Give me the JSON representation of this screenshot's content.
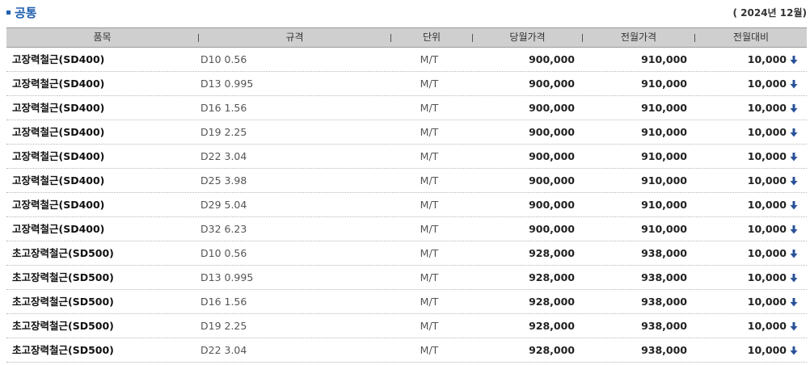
{
  "section": {
    "title": "공통",
    "period": "( 2024년 12월)"
  },
  "table": {
    "headers": {
      "item": "품목",
      "spec": "규격",
      "unit": "단위",
      "current_price": "당월가격",
      "previous_price": "전월가격",
      "change": "전월대비"
    },
    "rows": [
      {
        "item": "고장력철근(SD400)",
        "spec": "D10 0.56",
        "unit": "M/T",
        "current_price": "900,000",
        "previous_price": "910,000",
        "change": "10,000",
        "direction": "down"
      },
      {
        "item": "고장력철근(SD400)",
        "spec": "D13 0.995",
        "unit": "M/T",
        "current_price": "900,000",
        "previous_price": "910,000",
        "change": "10,000",
        "direction": "down"
      },
      {
        "item": "고장력철근(SD400)",
        "spec": "D16 1.56",
        "unit": "M/T",
        "current_price": "900,000",
        "previous_price": "910,000",
        "change": "10,000",
        "direction": "down"
      },
      {
        "item": "고장력철근(SD400)",
        "spec": "D19 2.25",
        "unit": "M/T",
        "current_price": "900,000",
        "previous_price": "910,000",
        "change": "10,000",
        "direction": "down"
      },
      {
        "item": "고장력철근(SD400)",
        "spec": "D22 3.04",
        "unit": "M/T",
        "current_price": "900,000",
        "previous_price": "910,000",
        "change": "10,000",
        "direction": "down"
      },
      {
        "item": "고장력철근(SD400)",
        "spec": "D25 3.98",
        "unit": "M/T",
        "current_price": "900,000",
        "previous_price": "910,000",
        "change": "10,000",
        "direction": "down"
      },
      {
        "item": "고장력철근(SD400)",
        "spec": "D29 5.04",
        "unit": "M/T",
        "current_price": "900,000",
        "previous_price": "910,000",
        "change": "10,000",
        "direction": "down"
      },
      {
        "item": "고장력철근(SD400)",
        "spec": "D32 6.23",
        "unit": "M/T",
        "current_price": "900,000",
        "previous_price": "910,000",
        "change": "10,000",
        "direction": "down"
      },
      {
        "item": "초고장력철근(SD500)",
        "spec": "D10 0.56",
        "unit": "M/T",
        "current_price": "928,000",
        "previous_price": "938,000",
        "change": "10,000",
        "direction": "down"
      },
      {
        "item": "초고장력철근(SD500)",
        "spec": "D13 0.995",
        "unit": "M/T",
        "current_price": "928,000",
        "previous_price": "938,000",
        "change": "10,000",
        "direction": "down"
      },
      {
        "item": "초고장력철근(SD500)",
        "spec": "D16 1.56",
        "unit": "M/T",
        "current_price": "928,000",
        "previous_price": "938,000",
        "change": "10,000",
        "direction": "down"
      },
      {
        "item": "초고장력철근(SD500)",
        "spec": "D19 2.25",
        "unit": "M/T",
        "current_price": "928,000",
        "previous_price": "938,000",
        "change": "10,000",
        "direction": "down"
      },
      {
        "item": "초고장력철근(SD500)",
        "spec": "D22 3.04",
        "unit": "M/T",
        "current_price": "928,000",
        "previous_price": "938,000",
        "change": "10,000",
        "direction": "down"
      }
    ]
  },
  "icons": {
    "change_down": "arrow-down-icon"
  },
  "colors": {
    "accent": "#1f5fb0",
    "header_bg": "#cfcfcf",
    "arrow": "#2a5298"
  }
}
